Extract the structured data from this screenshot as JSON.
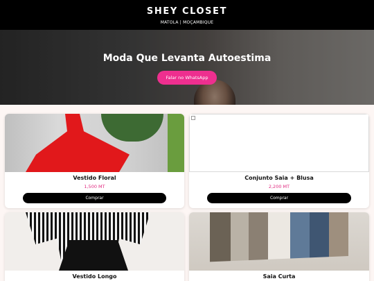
{
  "header": {
    "brand": "SHEY CLOSET",
    "location": "MATOLA | MOÇAMBIQUE"
  },
  "hero": {
    "title": "Moda Que Levanta Autoestima",
    "cta_label": "Falar no WhatsApp"
  },
  "products": [
    {
      "name": "Vestido Floral",
      "price": "1,500 MT",
      "buy_label": "Comprar"
    },
    {
      "name": "Conjunto Saia + Blusa",
      "price": "2,200 MT",
      "buy_label": "Comprar"
    },
    {
      "name": "Vestido Longo",
      "price": "",
      "buy_label": ""
    },
    {
      "name": "Saia Curta",
      "price": "",
      "buy_label": ""
    }
  ],
  "colors": {
    "header_bg": "#000000",
    "accent_pink": "#ee2f8f",
    "price_pink": "#e0287f",
    "page_bg": "#fdf6f4"
  }
}
